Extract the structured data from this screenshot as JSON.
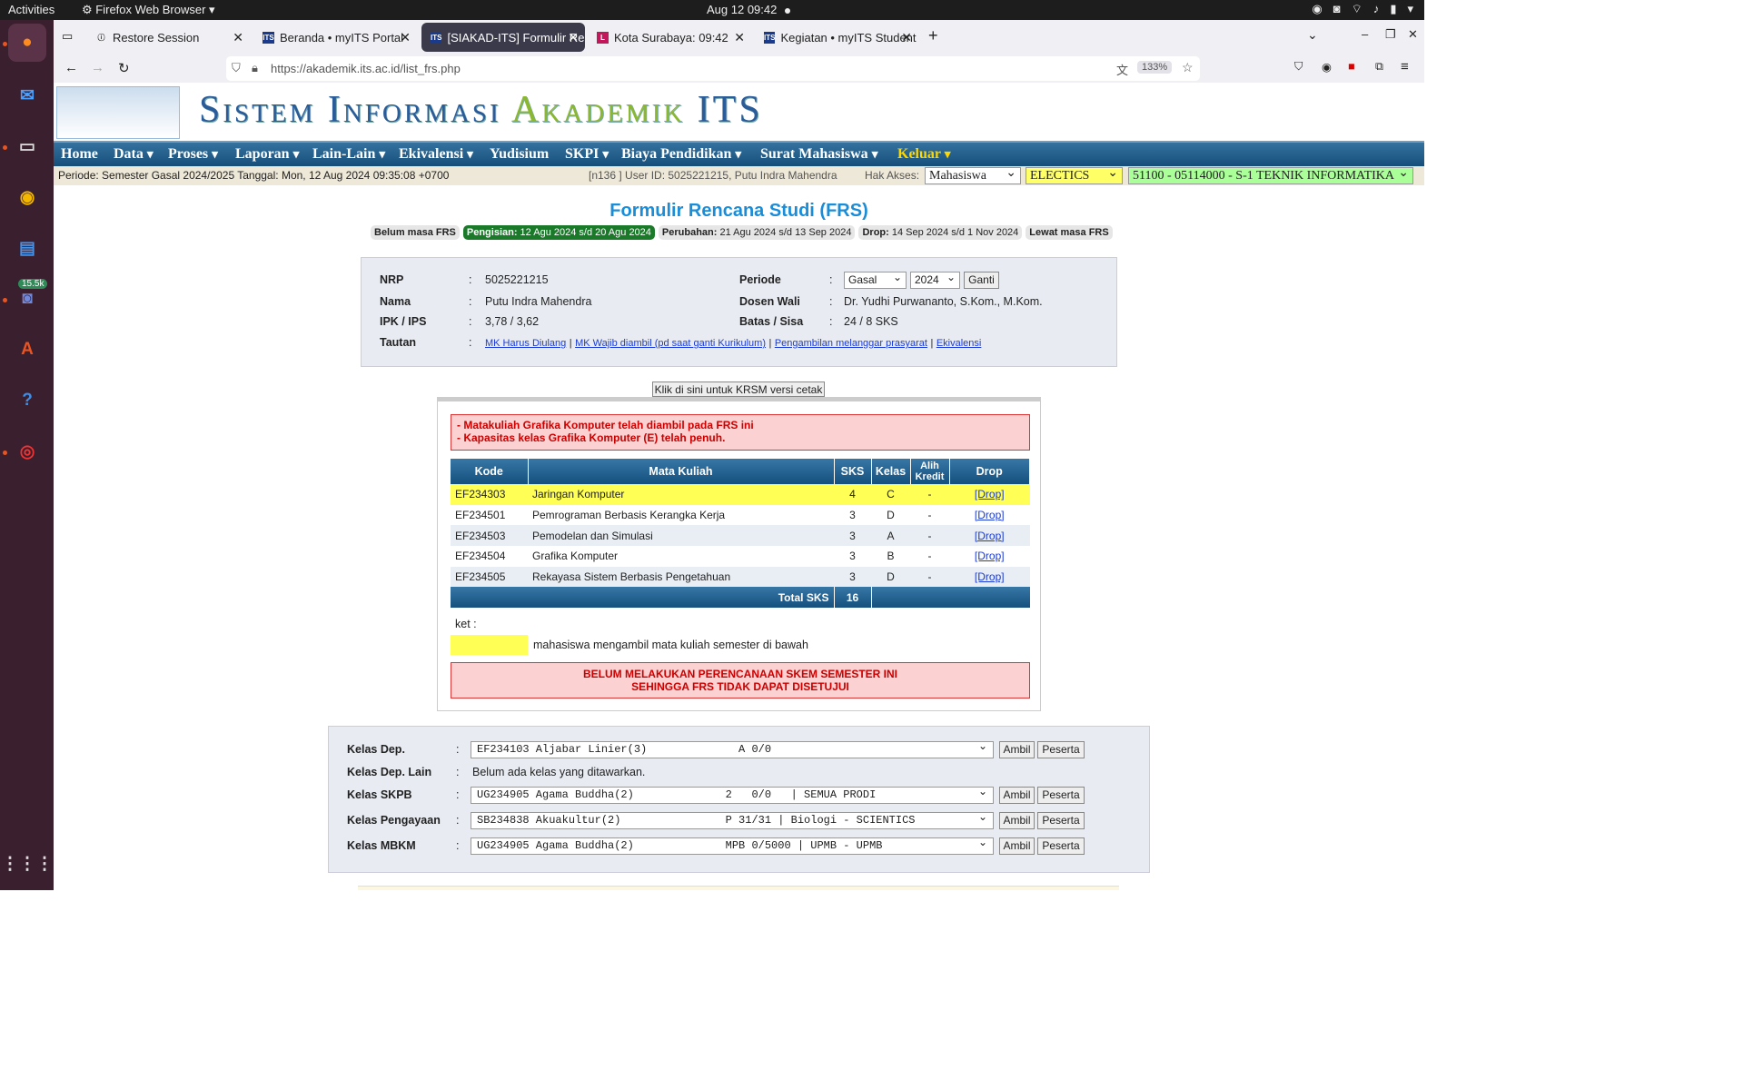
{
  "system": {
    "activities": "Activities",
    "app_name": "Firefox Web Browser",
    "clock": "Aug 12  09:42"
  },
  "dock": {
    "badge": "15.5k"
  },
  "tabs": [
    {
      "label": "Restore Session"
    },
    {
      "label": "Beranda • myITS Portal"
    },
    {
      "label": "[SIAKAD-ITS] Formulir Re"
    },
    {
      "label": "Kota Surabaya: 09:42"
    },
    {
      "label": "Kegiatan • myITS Student"
    }
  ],
  "browser": {
    "url": "https://akademik.its.ac.id/list_frs.php",
    "zoom": "133%"
  },
  "banner": {
    "title_a": "Sistem Informasi ",
    "title_b": "Akademik ",
    "title_c": "ITS"
  },
  "menu": [
    "Home",
    "Data",
    "Proses",
    "Laporan",
    "Lain-Lain",
    "Ekivalensi",
    "Yudisium",
    "SKPI",
    "Biaya Pendidikan",
    "Surat Mahasiswa",
    "Keluar"
  ],
  "infobar": {
    "periode": "Periode: Semester Gasal 2024/2025 Tanggal: Mon, 12 Aug 2024 09:35:08 +0700",
    "user": "[n136 ] User ID: 5025221215, Putu Indra Mahendra",
    "hak_label": "Hak Akses:",
    "hak_value": "Mahasiswa",
    "group": "ELECTICS",
    "prodi": "51100 - 05114000 - S-1 TEKNIK INFORMATIKA"
  },
  "heading": "Formulir Rencana Studi (FRS)",
  "phases": [
    {
      "b": "Belum masa FRS",
      "t": ""
    },
    {
      "b": "Pengisian:",
      "t": " 12 Agu 2024 s/d 20 Agu 2024"
    },
    {
      "b": "Perubahan:",
      "t": " 21 Agu 2024 s/d 13 Sep 2024"
    },
    {
      "b": "Drop:",
      "t": " 14 Sep 2024 s/d 1 Nov 2024"
    },
    {
      "b": "Lewat masa FRS",
      "t": ""
    }
  ],
  "student": {
    "nrp_l": "NRP",
    "nrp": "5025221215",
    "nama_l": "Nama",
    "nama": "Putu Indra Mahendra",
    "ipk_l": "IPK / IPS",
    "ipk": "3,78 / 3,62",
    "taut_l": "Tautan",
    "links": [
      "MK Harus Diulang",
      "MK Wajib diambil (pd saat ganti Kurikulum)",
      "Pengambilan melanggar prasyarat",
      "Ekivalensi"
    ],
    "periode_l": "Periode",
    "sem": "Gasal",
    "year": "2024",
    "ganti": "Ganti",
    "wali_l": "Dosen Wali",
    "wali": "Dr. Yudhi Purwananto, S.Kom., M.Kom.",
    "batas_l": "Batas / Sisa",
    "batas": "24 / 8 SKS",
    "sep": ":"
  },
  "print_btn": "Klik di sini untuk KRSM versi cetak",
  "alert_top": [
    "- Matakuliah Grafika Komputer telah diambil pada FRS ini",
    "- Kapasitas kelas Grafika Komputer (E) telah penuh."
  ],
  "table": {
    "headers": [
      "Kode",
      "Mata Kuliah",
      "SKS",
      "Kelas",
      "Alih Kredit",
      "Drop"
    ],
    "rows": [
      {
        "kode": "EF234303",
        "mk": "Jaringan Komputer",
        "sks": "4",
        "kelas": "C",
        "alih": "-",
        "drop": "[Drop]"
      },
      {
        "kode": "EF234501",
        "mk": "Pemrograman Berbasis Kerangka Kerja",
        "sks": "3",
        "kelas": "D",
        "alih": "-",
        "drop": "[Drop]"
      },
      {
        "kode": "EF234503",
        "mk": "Pemodelan dan Simulasi",
        "sks": "3",
        "kelas": "A",
        "alih": "-",
        "drop": "[Drop]"
      },
      {
        "kode": "EF234504",
        "mk": "Grafika Komputer",
        "sks": "3",
        "kelas": "B",
        "alih": "-",
        "drop": "[Drop]"
      },
      {
        "kode": "EF234505",
        "mk": "Rekayasa Sistem Berbasis Pengetahuan",
        "sks": "3",
        "kelas": "D",
        "alih": "-",
        "drop": "[Drop]"
      }
    ],
    "total_l": "Total SKS",
    "total": "16"
  },
  "ket": {
    "label": "ket :",
    "text": "mahasiswa mengambil mata kuliah semester di bawah"
  },
  "alert_bottom": [
    "BELUM MELAKUKAN PERENCANAAN SKEM SEMESTER INI",
    "SEHINGGA FRS TIDAK DAPAT DISETUJUI"
  ],
  "kelas": {
    "sep": ":",
    "dep_l": "Kelas Dep.",
    "dep": "EF234103 Aljabar Linier(3)              A 0/0",
    "lain_l": "Kelas Dep. Lain",
    "lain": "Belum ada kelas yang ditawarkan.",
    "skpb_l": "Kelas SKPB",
    "skpb": "UG234905 Agama Buddha(2)              2   0/0   | SEMUA PRODI",
    "peng_l": "Kelas Pengayaan",
    "peng": "SB234838 Akuakultur(2)                P 31/31 | Biologi - SCIENTICS",
    "mbkm_l": "Kelas MBKM",
    "mbkm": "UG234905 Agama Buddha(2)              MPB 0/5000 | UPMB - UPMB",
    "ambil": "Ambil",
    "peserta": "Peserta"
  }
}
